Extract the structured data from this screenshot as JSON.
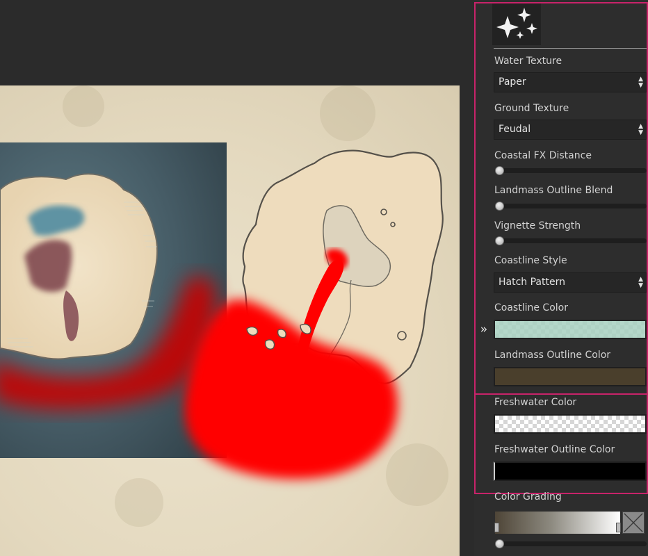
{
  "panel": {
    "effects_icon": "sparkles-icon",
    "water_texture": {
      "label": "Water Texture",
      "value": "Paper"
    },
    "ground_texture": {
      "label": "Ground Texture",
      "value": "Feudal"
    },
    "coastal_fx_distance": {
      "label": "Coastal FX Distance",
      "level": 0
    },
    "landmass_outline_blend": {
      "label": "Landmass Outline Blend",
      "level": 0
    },
    "vignette_strength": {
      "label": "Vignette Strength",
      "level": 0
    },
    "coastline_style": {
      "label": "Coastline Style",
      "value": "Hatch Pattern"
    },
    "coastline_color": {
      "label": "Coastline Color",
      "color": "#a7d0c0"
    },
    "landmass_outline_color": {
      "label": "Landmass Outline Color",
      "color": "#4a3f2c"
    },
    "freshwater_color": {
      "label": "Freshwater Color",
      "color": "transparent"
    },
    "freshwater_outline_color": {
      "label": "Freshwater Outline Color",
      "color": "#000000"
    },
    "color_grading": {
      "label": "Color Grading",
      "gradient": [
        "#4e4537",
        "#ffffff"
      ],
      "level": 0
    }
  },
  "collapse_icon": "double-chevron-right-icon",
  "colors": {
    "highlight_border": "#c8236a",
    "paint_red": "#ff0000",
    "parchment": "#e8dec6",
    "sea": "#3f5560",
    "land_outline": "#55514a"
  }
}
